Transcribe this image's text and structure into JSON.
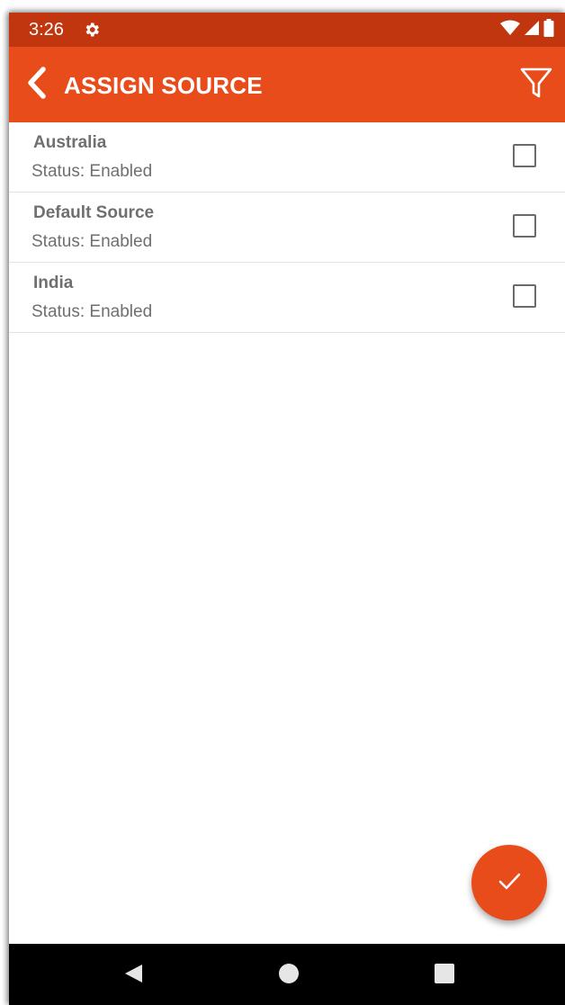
{
  "status_bar": {
    "time": "3:26",
    "icons": [
      "gear-icon",
      "wifi-icon",
      "signal-icon",
      "battery-icon"
    ]
  },
  "app_bar": {
    "title": "ASSIGN SOURCE",
    "back_icon": "chevron-left-icon",
    "filter_icon": "filter-icon"
  },
  "colors": {
    "status_bar": "#c2360f",
    "app_bar": "#e84c1a",
    "fab": "#e84c1a",
    "text_secondary": "#6f6f6f",
    "divider": "#e2e2e2",
    "nav_bar": "#000000"
  },
  "sources": [
    {
      "name": "Australia",
      "status": "Status: Enabled",
      "checked": false
    },
    {
      "name": "Default Source",
      "status": "Status: Enabled",
      "checked": false
    },
    {
      "name": "India",
      "status": "Status: Enabled",
      "checked": false
    }
  ],
  "fab": {
    "icon": "checkmark-icon"
  },
  "nav_bar": {
    "icons": [
      "back-triangle-icon",
      "home-circle-icon",
      "recents-square-icon"
    ]
  }
}
